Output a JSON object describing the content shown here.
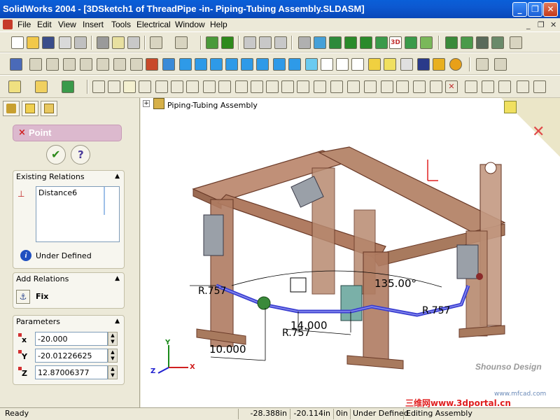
{
  "window": {
    "title": "SolidWorks 2004 - [3DSketch1 of ThreadPipe -in- Piping-Tubing Assembly.SLDASM]"
  },
  "menu": {
    "items": [
      "File",
      "Edit",
      "View",
      "Insert",
      "Tools",
      "Electrical",
      "Window",
      "Help"
    ],
    "doc_controls": [
      "_",
      "❐",
      "✕"
    ]
  },
  "feature_tree": {
    "root_label": "Piping-Tubing Assembly",
    "expand_glyph": "+"
  },
  "property_manager": {
    "header": "Point",
    "buttons": {
      "ok_glyph": "✔",
      "help_glyph": "?"
    },
    "existing_relations": {
      "title": "Existing Relations",
      "items": [
        "Distance6"
      ],
      "status": "Under Defined"
    },
    "add_relations": {
      "title": "Add Relations",
      "fix_label": "Fix"
    },
    "parameters": {
      "title": "Parameters",
      "x_label": "x",
      "x_value": "-20.000",
      "y_label": "Y",
      "y_value": "-20.01226625",
      "z_label": "Z",
      "z_value": "12.87006377"
    }
  },
  "viewport": {
    "dimensions": {
      "angle": "135.00°",
      "radius1": "R.757",
      "length1": "14.000",
      "radius2": "R.757",
      "radius3": "R.757",
      "length2": "10.000"
    },
    "triad": {
      "x": "X",
      "y": "Y",
      "z": "Z"
    },
    "watermark": "Shounso Design",
    "corner_logo": "三维网www.3dportal.cn",
    "site_mark": "www.mfcad.com"
  },
  "status_bar": {
    "ready": "Ready",
    "x": "-28.388in",
    "y": "-20.114in",
    "z": "0in",
    "state": "Under Defined",
    "editing": "Editing Assembly"
  },
  "colors": {
    "titlebar": "#0a5fd8",
    "frame_steel": "#a87a5e",
    "pipe": "#3a3ed0",
    "pm_header": "#dcb9ce",
    "ok_green": "#2e8a1c"
  }
}
